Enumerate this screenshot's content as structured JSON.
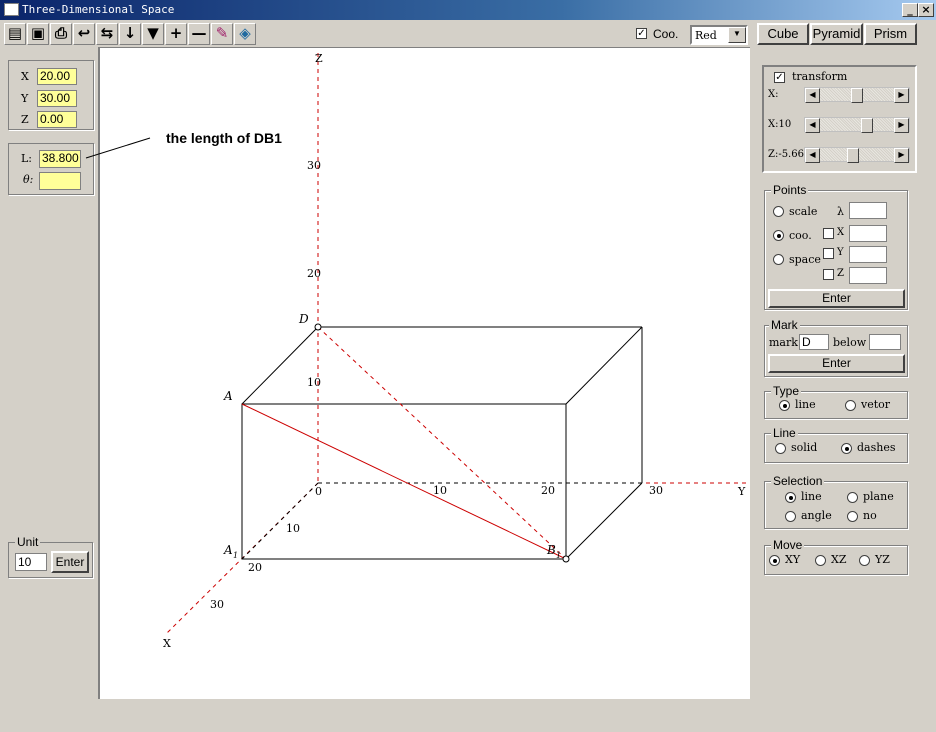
{
  "window": {
    "title": "Three-Dimensional Space"
  },
  "toolbar": {
    "icons": [
      "open-icon",
      "save-icon",
      "print-icon",
      "undo-arrow-icon",
      "align-icon",
      "down-arrow-icon",
      "funnel-icon",
      "plus-icon",
      "minus-icon",
      "paint-icon",
      "transform-icon"
    ],
    "coo_label": "Coo.",
    "coo_checked": true,
    "color_value": "Red"
  },
  "shape_buttons": [
    "Cube",
    "Pyramid",
    "Prism"
  ],
  "coords": {
    "x_label": "X",
    "x_value": "20.00",
    "y_label": "Y",
    "y_value": "30.00",
    "z_label": "Z",
    "z_value": "0.00"
  },
  "measure": {
    "l_label": "L:",
    "l_value": "38.800",
    "theta_label": "θ:",
    "theta_value": ""
  },
  "annotation": "the length of DB1",
  "unit": {
    "label": "Unit",
    "value": "10",
    "enter": "Enter"
  },
  "transform": {
    "label": "transform",
    "checked": true,
    "x_label": "X:",
    "y_label": "X:10",
    "z_label": "Z:-5.66"
  },
  "points": {
    "title": "Points",
    "scale": "scale",
    "lambda": "λ",
    "coo": "coo.",
    "space": "space",
    "x": "X",
    "y": "Y",
    "z": "Z",
    "enter": "Enter"
  },
  "mark": {
    "title": "Mark",
    "mark_label": "mark",
    "mark_value": "D",
    "below_label": "below",
    "enter": "Enter"
  },
  "type": {
    "title": "Type",
    "line": "line",
    "vetor": "vetor"
  },
  "line": {
    "title": "Line",
    "solid": "solid",
    "dashes": "dashes"
  },
  "selection": {
    "title": "Selection",
    "line": "line",
    "plane": "plane",
    "angle": "angle",
    "no": "no"
  },
  "move": {
    "title": "Move",
    "xy": "XY",
    "xz": "XZ",
    "yz": "YZ"
  },
  "scene": {
    "axis_z": "Z",
    "axis_y": "Y",
    "axis_x": "X",
    "origin": "0",
    "z_ticks": [
      "10",
      "20",
      "30"
    ],
    "y_ticks": [
      "10",
      "20",
      "30"
    ],
    "x_ticks": [
      "10",
      "20",
      "30"
    ],
    "points": {
      "D": "D",
      "A": "A",
      "A1": "A",
      "B1": "B",
      "sub1": "1"
    },
    "colors": {
      "axis": "#cc0000",
      "edge": "#000000",
      "diagonal": "#cc0000"
    }
  }
}
